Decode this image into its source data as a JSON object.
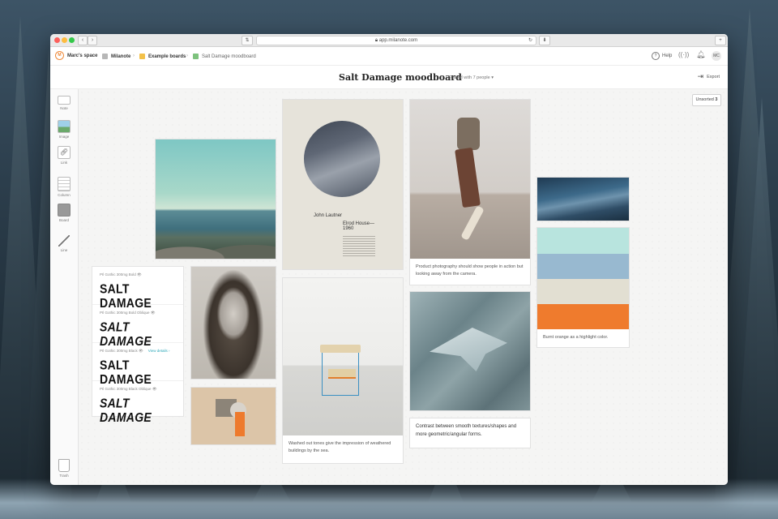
{
  "browser": {
    "url": "app.milanote.com"
  },
  "breadcrumb": {
    "items": [
      {
        "label": "Marc's space",
        "color": "#ef8a3a"
      },
      {
        "label": "Milanote",
        "color": "#b7b7b7"
      },
      {
        "label": "Example boards",
        "color": "#f3c14a"
      },
      {
        "label": "Salt Damage moodboard",
        "color": "#7dc27d"
      }
    ]
  },
  "appbar": {
    "help_label": "Help",
    "avatar_initials": "MC"
  },
  "header": {
    "title": "Salt Damage moodboard",
    "shared_label": "Shared with 7 people",
    "export_label": "Export"
  },
  "sidebar": {
    "tools": [
      {
        "label": "Note",
        "icon": "note-icon"
      },
      {
        "label": "Image",
        "icon": "image-icon"
      },
      {
        "label": "Link",
        "icon": "link-icon"
      },
      {
        "label": "Column",
        "icon": "column-icon"
      },
      {
        "label": "Board",
        "icon": "board-icon"
      },
      {
        "label": "Line",
        "icon": "line-icon"
      }
    ],
    "trash_label": "Trash"
  },
  "unsorted": {
    "label": "Unsorted",
    "count": "3"
  },
  "typography": {
    "rows": [
      {
        "meta": "PIl Gothic 300mg Bold",
        "sample": "SALT DAMAGE",
        "italic": false,
        "link": ""
      },
      {
        "meta": "PIl Gothic 300mg Bold Oblique",
        "sample": "SALT DAMAGE",
        "italic": true,
        "link": ""
      },
      {
        "meta": "PIl Gothic 300mg Black",
        "sample": "SALT DAMAGE",
        "italic": false,
        "link": "View details ›"
      },
      {
        "meta": "PIl Gothic 300mg Black Oblique",
        "sample": "SALT DAMAGE",
        "italic": true,
        "link": ""
      }
    ]
  },
  "poster": {
    "name": "John Lautner",
    "subtitle": "Elrod House—",
    "year": "1960"
  },
  "captions": {
    "chair": "Washed out tones give the impression of weathered buildings by the sea.",
    "skater": "Product photography should show people in action but looking away from the camera.",
    "origami": "Contrast between smooth textures/shapes and more geometric/angular forms.",
    "palette": "Burnt orange as a highlight color."
  },
  "palette": {
    "swatches": [
      "#b8e4de",
      "#98b9d0",
      "#e2dfd2",
      "#ef7b2d"
    ]
  }
}
